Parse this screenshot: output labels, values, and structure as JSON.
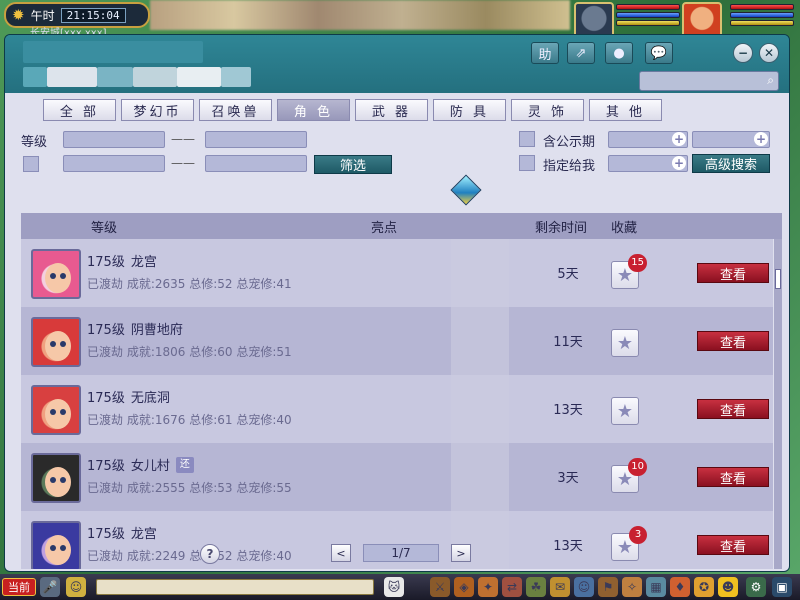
{
  "hud_top": {
    "period": "午时",
    "time": "21:15:04",
    "location": "长安城[xxx,xxx]"
  },
  "window": {
    "head_buttons": {
      "help": "助",
      "share": "⇗",
      "record": "●",
      "chat": "💬"
    },
    "minimize": "−",
    "close": "✕",
    "search_icon": "search-icon"
  },
  "tabs": [
    {
      "label": "全 部",
      "active": false
    },
    {
      "label": "梦幻币",
      "active": false
    },
    {
      "label": "召唤兽",
      "active": false
    },
    {
      "label": "角 色",
      "active": true
    },
    {
      "label": "武 器",
      "active": false
    },
    {
      "label": "防 具",
      "active": false
    },
    {
      "label": "灵 饰",
      "active": false
    },
    {
      "label": "其 他",
      "active": false
    }
  ],
  "filters": {
    "level_label": "等级",
    "range_sep": "——",
    "filter_button": "筛选",
    "public_period_label": "含公示期",
    "assigned_label": "指定给我",
    "advanced_search": "高级搜索"
  },
  "table": {
    "headers": {
      "level": "等级",
      "highlights": "亮点",
      "remaining": "剩余时间",
      "favorite": "收藏"
    },
    "view_label": "查看",
    "rows": [
      {
        "level": "175级",
        "school": "龙宫",
        "tag": "",
        "stats": "已渡劫 成就:2635 总修:52 总宠修:41",
        "remaining": "5天",
        "favorites": "15",
        "avatar_colors": [
          "#e85a90",
          "#f4d0e0"
        ]
      },
      {
        "level": "175级",
        "school": "阴曹地府",
        "tag": "",
        "stats": "已渡劫 成就:1806 总修:60 总宠修:51",
        "remaining": "11天",
        "favorites": "",
        "avatar_colors": [
          "#d83a3a",
          "#f0a080"
        ]
      },
      {
        "level": "175级",
        "school": "无底洞",
        "tag": "",
        "stats": "已渡劫 成就:1676 总修:61 总宠修:40",
        "remaining": "13天",
        "favorites": "",
        "avatar_colors": [
          "#d84040",
          "#f0a080"
        ]
      },
      {
        "level": "175级",
        "school": "女儿村",
        "tag": "还",
        "stats": "已渡劫 成就:2555 总修:53 总宠修:55",
        "remaining": "3天",
        "favorites": "10",
        "avatar_colors": [
          "#2a2a2a",
          "#5a7a5a"
        ]
      },
      {
        "level": "175级",
        "school": "龙宫",
        "tag": "",
        "stats": "已渡劫 成就:2249 总修:52 总宠修:40",
        "remaining": "13天",
        "favorites": "3",
        "avatar_colors": [
          "#3a3aa0",
          "#c0a0e0"
        ]
      }
    ]
  },
  "pagination": {
    "help": "?",
    "prev": "<",
    "page": "1/7",
    "next": ">"
  },
  "hud_bottom": {
    "current_channel": "当前"
  }
}
